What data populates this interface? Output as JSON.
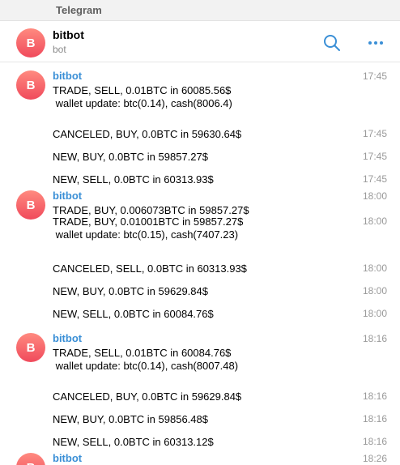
{
  "window": {
    "title": "Telegram"
  },
  "chat": {
    "name": "bitbot",
    "status": "bot",
    "avatar_letter": "B",
    "avatar_colors": [
      "#ff8a80",
      "#f04a5c"
    ],
    "accent_color": "#3a8fd6"
  },
  "header_icons": [
    "search-icon",
    "more-icon"
  ],
  "groups": [
    {
      "sender": "bitbot",
      "messages": [
        {
          "lines": [
            "TRADE, SELL, 0.01BTC in 60085.56$",
            " wallet update: btc(0.14), cash(8006.4)"
          ],
          "time": "17:45"
        },
        {
          "lines": [
            "CANCELED, BUY, 0.0BTC in 59630.64$"
          ],
          "time": "17:45"
        },
        {
          "lines": [
            "NEW, BUY, 0.0BTC in 59857.27$"
          ],
          "time": "17:45"
        },
        {
          "lines": [
            "NEW, SELL, 0.0BTC in 60313.93$"
          ],
          "time": "17:45"
        }
      ]
    },
    {
      "sender": "bitbot",
      "messages": [
        {
          "lines": [
            "TRADE, BUY, 0.006073BTC in 59857.27$"
          ],
          "time": "18:00"
        },
        {
          "lines": [
            "TRADE, BUY, 0.01001BTC in 59857.27$",
            " wallet update: btc(0.15), cash(7407.23)"
          ],
          "time": "18:00"
        },
        {
          "lines": [
            "CANCELED, SELL, 0.0BTC in 60313.93$"
          ],
          "time": "18:00"
        },
        {
          "lines": [
            "NEW, BUY, 0.0BTC in 59629.84$"
          ],
          "time": "18:00"
        },
        {
          "lines": [
            "NEW, SELL, 0.0BTC in 60084.76$"
          ],
          "time": "18:00"
        }
      ]
    },
    {
      "sender": "bitbot",
      "messages": [
        {
          "lines": [
            "TRADE, SELL, 0.01BTC in 60084.76$",
            " wallet update: btc(0.14), cash(8007.48)"
          ],
          "time": "18:16"
        },
        {
          "lines": [
            "CANCELED, BUY, 0.0BTC in 59629.84$"
          ],
          "time": "18:16"
        },
        {
          "lines": [
            "NEW, BUY, 0.0BTC in 59856.48$"
          ],
          "time": "18:16"
        },
        {
          "lines": [
            "NEW, SELL, 0.0BTC in 60313.12$"
          ],
          "time": "18:16"
        }
      ]
    },
    {
      "sender": "bitbot",
      "messages": [
        {
          "lines": [],
          "time": "18:26"
        }
      ]
    }
  ]
}
